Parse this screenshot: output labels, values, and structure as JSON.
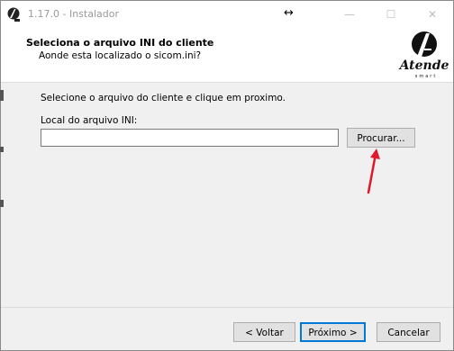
{
  "window": {
    "title": "1.17.0 - Instalador",
    "minimize_icon": "minimize-icon",
    "maximize_icon": "maximize-icon",
    "close_icon": "close-icon"
  },
  "header": {
    "title": "Seleciona o arquivo INI do cliente",
    "subtitle": "Aonde esta localizado o sicom.ini?",
    "logo_text": "Atende",
    "logo_subtext": "smart"
  },
  "content": {
    "instruction": "Selecione o arquivo do cliente e clique em proximo.",
    "field_label": "Local do arquivo INI:",
    "path_value": "",
    "browse_label": "Procurar..."
  },
  "footer": {
    "back_label": "< Voltar",
    "next_label": "Próximo >",
    "cancel_label": "Cancelar"
  },
  "colors": {
    "accent": "#0078d7",
    "arrow": "#e0182d"
  }
}
